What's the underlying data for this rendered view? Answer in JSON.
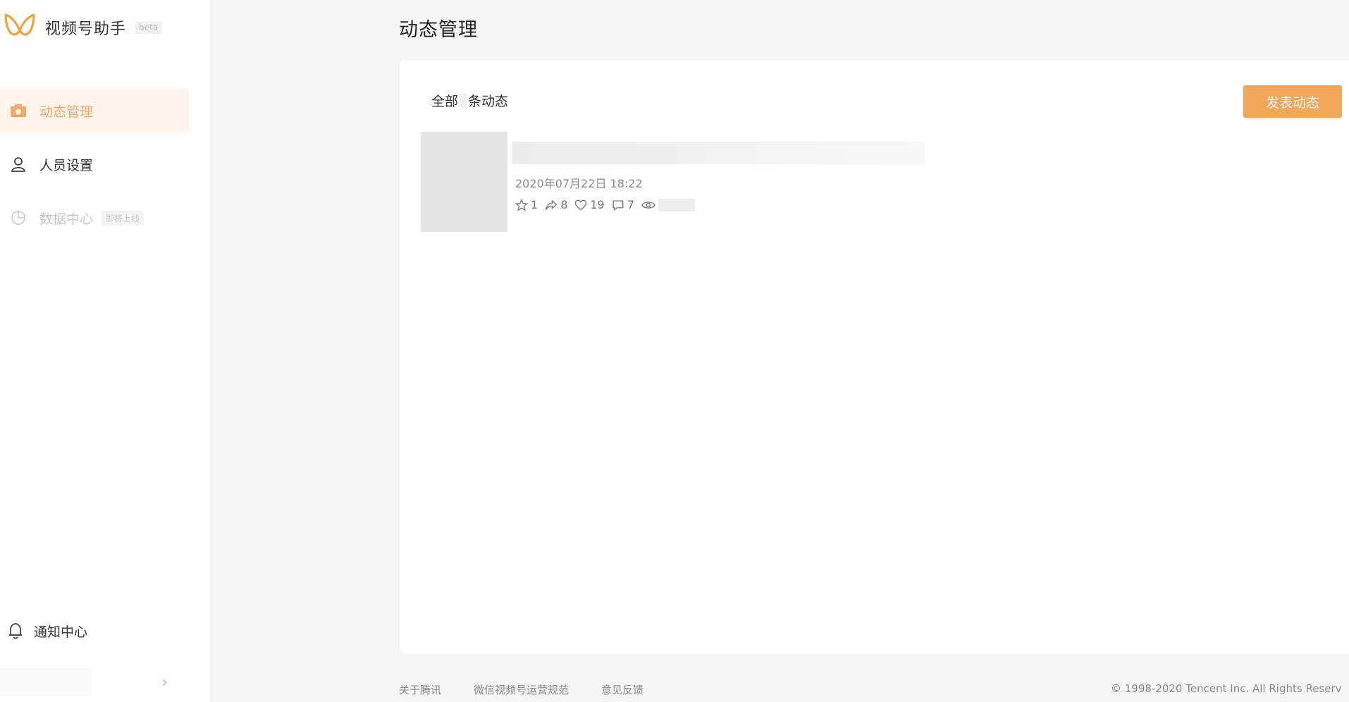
{
  "brand": {
    "title": "视频号助手",
    "beta": "beta"
  },
  "sidebar": {
    "items": [
      {
        "label": "动态管理",
        "icon": "camera-icon",
        "active": true
      },
      {
        "label": "人员设置",
        "icon": "user-icon"
      },
      {
        "label": "数据中心",
        "icon": "pie-chart-icon",
        "badge": "即将上线",
        "disabled": true
      }
    ],
    "notify_label": "通知中心",
    "collapse_icon": "chevron-right-icon"
  },
  "main": {
    "title": "动态管理",
    "filter_prefix": "全部",
    "filter_suffix": "条动态",
    "publish_label": "发表动态"
  },
  "post": {
    "date": "2020年07月22日 18:22",
    "stats": {
      "favorites": "1",
      "shares": "8",
      "likes": "19",
      "comments": "7"
    }
  },
  "footer": {
    "links": [
      "关于腾讯",
      "微信视频号运营规范",
      "意见反馈"
    ],
    "copyright": "© 1998-2020 Tencent Inc. All Rights Reserv"
  },
  "colors": {
    "accent": "#f0a75a",
    "active_bg": "#fff5ec",
    "active_text": "#f3a968"
  }
}
